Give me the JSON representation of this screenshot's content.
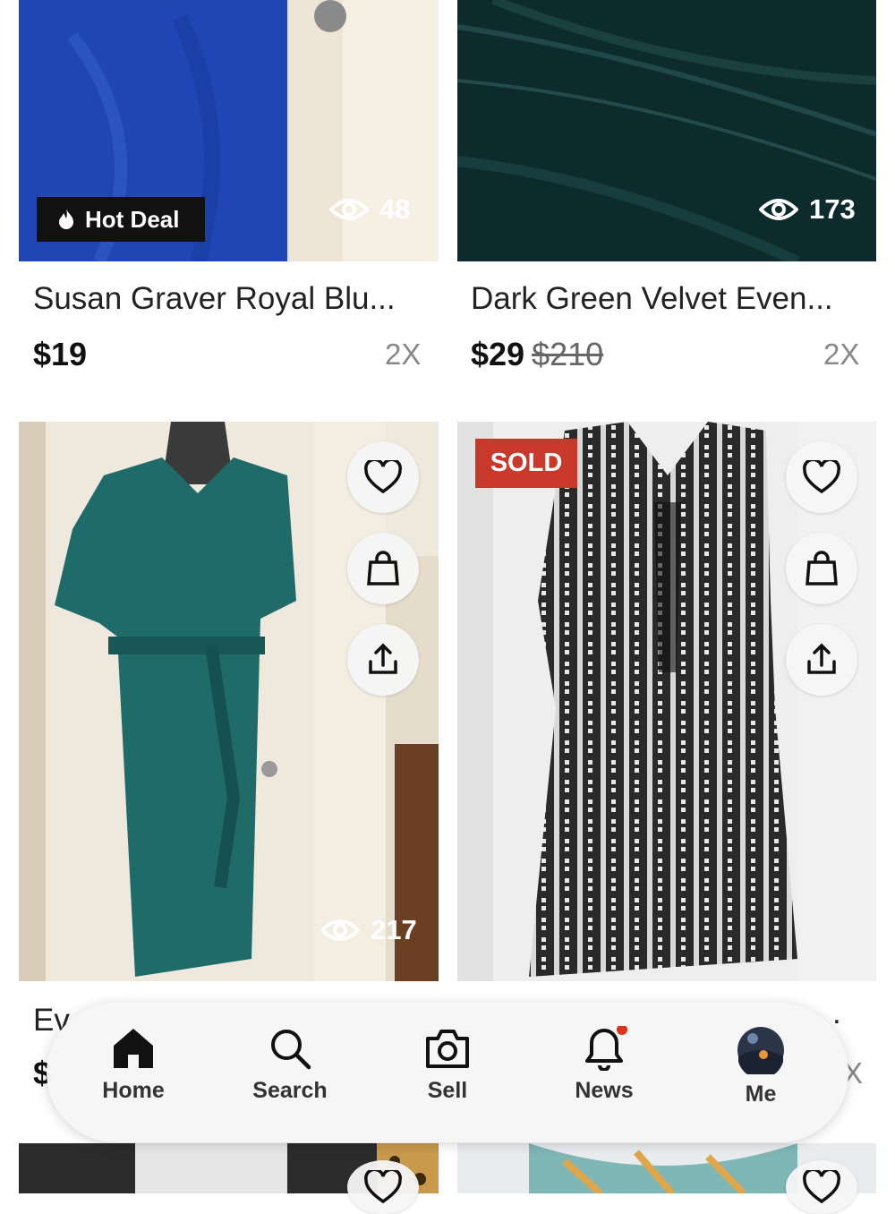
{
  "listings": [
    {
      "title": "Susan Graver Royal Blu...",
      "price": "$19",
      "original_price": "",
      "size": "2X",
      "views": "48",
      "badge": "Hot Deal"
    },
    {
      "title": "Dark Green Velvet Even...",
      "price": "$29",
      "original_price": "$210",
      "size": "2X",
      "views": "173",
      "badge": ""
    },
    {
      "title": "Ev",
      "price": "$",
      "original_price": "",
      "size": "",
      "views": "217",
      "badge": ""
    },
    {
      "title": ".",
      "price": "",
      "original_price": "",
      "size": "X",
      "views": "",
      "badge": "SOLD"
    }
  ],
  "icons": {
    "heart": "heart-icon",
    "bag": "shopping-bag-icon",
    "share": "share-icon",
    "eye": "eye-icon",
    "flame": "flame-icon"
  },
  "nav": {
    "items": [
      {
        "label": "Home",
        "icon": "home-icon"
      },
      {
        "label": "Search",
        "icon": "search-icon"
      },
      {
        "label": "Sell",
        "icon": "camera-icon"
      },
      {
        "label": "News",
        "icon": "bell-icon",
        "notification_dot": true
      },
      {
        "label": "Me",
        "icon": "avatar"
      }
    ]
  },
  "colors": {
    "sold_badge": "#c8392b",
    "hot_deal_badge": "#111111",
    "notification_dot": "#e0301e"
  }
}
